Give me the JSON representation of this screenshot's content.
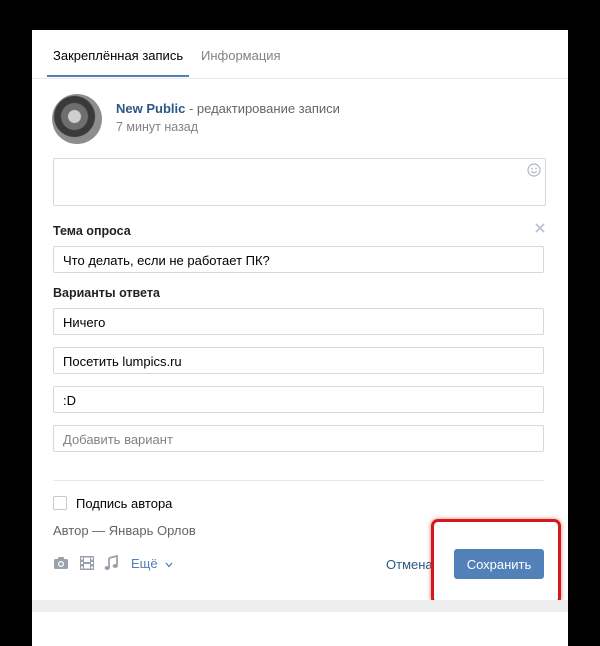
{
  "tabs": [
    {
      "label": "Закреплённая запись"
    },
    {
      "label": "Информация"
    }
  ],
  "post": {
    "author": "New Public",
    "action": " - редактирование записи",
    "time": "7 минут назад"
  },
  "poll": {
    "topic_label": "Тема опроса",
    "topic_value": "Что делать, если не работает ПК?",
    "options_label": "Варианты ответа",
    "options": [
      "Ничего",
      "Посетить lumpics.ru",
      ":D"
    ],
    "add_placeholder": "Добавить вариант"
  },
  "signature": {
    "checkbox_label": "Подпись автора",
    "author_line": "Автор — Январь Орлов"
  },
  "toolbar": {
    "more_label": "Ещё",
    "cancel_label": "Отмена",
    "save_label": "Сохранить"
  },
  "colors": {
    "accent": "#5181b8",
    "link": "#2a5885",
    "highlight": "#d11a1a"
  }
}
